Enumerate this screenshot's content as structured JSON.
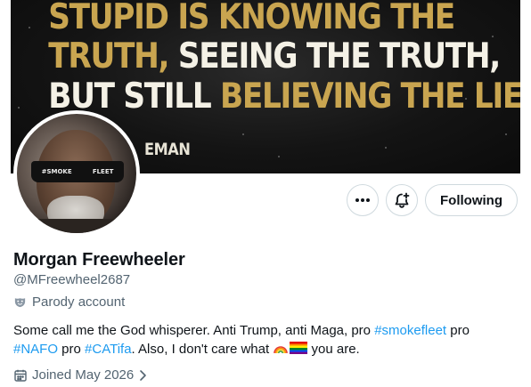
{
  "banner": {
    "line1_a": "STUPID IS KNOWING THE",
    "line2_a": "TRUTH,",
    "line2_b": " SEEING THE TRUTH,",
    "line3_a": "BUT STILL ",
    "line3_b": "BELIEVING THE LIES.",
    "attribution": "EMAN",
    "colors": {
      "gold": "#c9a550",
      "cream": "#f4f1e6",
      "background": "#141414"
    }
  },
  "avatar": {
    "glasses_left": "#SMOKE",
    "glasses_right": "FLEET"
  },
  "actions": {
    "more_icon": "more-icon",
    "subscribe_icon": "bell-plus-icon",
    "follow_label": "Following"
  },
  "profile": {
    "name": "Morgan Freewheeler",
    "handle": "@MFreewheel2687",
    "parody_label": "Parody account",
    "bio": {
      "p1": "Some call me the God whisperer. Anti Trump, anti Maga, pro ",
      "tag1": "#smokefleet",
      "p2": " pro",
      "tag2": "#NAFO",
      "p3": " pro ",
      "tag3": "#CATifa",
      "p4": ". Also, I don't care what ",
      "p5": " you are."
    },
    "joined": "Joined May 2026",
    "link_color": "#1d9bf0"
  }
}
